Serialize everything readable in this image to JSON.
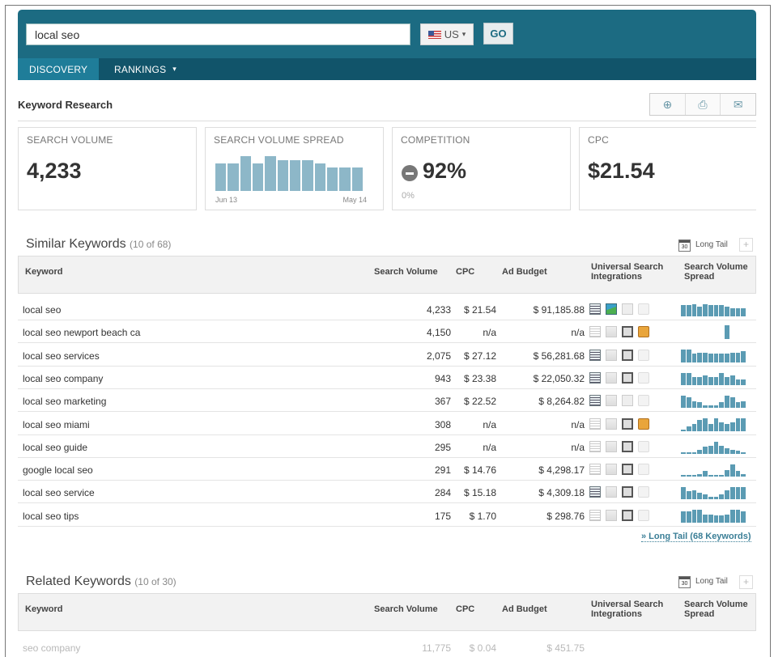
{
  "search": {
    "query": "local seo",
    "country": "US",
    "go_label": "GO"
  },
  "nav": {
    "tabs": [
      "DISCOVERY",
      "RANKINGS"
    ],
    "active": "DISCOVERY",
    "dropdown_caret": "▾"
  },
  "page_title": "Keyword Research",
  "toolbar": {
    "icons": [
      "add-icon",
      "pdf-icon",
      "email-icon"
    ],
    "glyphs": [
      "⊕",
      "⎙",
      "✉"
    ]
  },
  "cards": {
    "search_volume": {
      "label": "SEARCH VOLUME",
      "value": "4,233"
    },
    "spread": {
      "label": "SEARCH VOLUME SPREAD",
      "from": "Jun 13",
      "to": "May 14",
      "levels": [
        0.75,
        0.75,
        0.95,
        0.75,
        0.95,
        0.85,
        0.85,
        0.85,
        0.75,
        0.65,
        0.65,
        0.65
      ]
    },
    "competition": {
      "label": "COMPETITION",
      "value": "92%",
      "sub": "0%"
    },
    "cpc": {
      "label": "CPC",
      "value": "$21.54"
    }
  },
  "similar": {
    "title": "Similar Keywords",
    "count": "(10 of 68)",
    "long_tail_label": "Long Tail",
    "calendar_number": "30",
    "plus": "+",
    "more_link": "» Long Tail (68 Keywords)"
  },
  "columns": {
    "keyword": "Keyword",
    "volume": "Search Volume",
    "cpc": "CPC",
    "budget": "Ad Budget",
    "usi": "Universal Search Integrations",
    "spread": "Search Volume Spread"
  },
  "rows": [
    {
      "keyword": "local seo",
      "volume": "4,233",
      "cpc": "$ 21.54",
      "budget": "$ 91,185.88",
      "usi": [
        1,
        1,
        0,
        0
      ],
      "spread": [
        0.8,
        0.8,
        0.9,
        0.7,
        0.9,
        0.8,
        0.8,
        0.8,
        0.7,
        0.6,
        0.6,
        0.6
      ]
    },
    {
      "keyword": "local seo newport beach ca",
      "volume": "4,150",
      "cpc": "n/a",
      "budget": "n/a",
      "usi": [
        0,
        0,
        1,
        1
      ],
      "spread": [
        0,
        0,
        0,
        0,
        0,
        0,
        0,
        0,
        1,
        0,
        0,
        0
      ]
    },
    {
      "keyword": "local seo services",
      "volume": "2,075",
      "cpc": "$ 27.12",
      "budget": "$ 56,281.68",
      "usi": [
        1,
        0,
        1,
        0
      ],
      "spread": [
        0.9,
        0.9,
        0.6,
        0.7,
        0.7,
        0.6,
        0.6,
        0.6,
        0.6,
        0.7,
        0.7,
        0.8
      ]
    },
    {
      "keyword": "local seo company",
      "volume": "943",
      "cpc": "$ 23.38",
      "budget": "$ 22,050.32",
      "usi": [
        1,
        0,
        1,
        0
      ],
      "spread": [
        0.9,
        0.9,
        0.6,
        0.6,
        0.7,
        0.6,
        0.6,
        0.9,
        0.6,
        0.7,
        0.4,
        0.4
      ]
    },
    {
      "keyword": "local seo marketing",
      "volume": "367",
      "cpc": "$ 22.52",
      "budget": "$ 8,264.82",
      "usi": [
        1,
        0,
        0,
        0
      ],
      "spread": [
        0.9,
        0.8,
        0.5,
        0.4,
        0.2,
        0.2,
        0.2,
        0.4,
        0.9,
        0.8,
        0.4,
        0.5
      ]
    },
    {
      "keyword": "local seo miami",
      "volume": "308",
      "cpc": "n/a",
      "budget": "n/a",
      "usi": [
        0,
        0,
        1,
        1
      ],
      "spread": [
        0.1,
        0.3,
        0.5,
        0.8,
        0.9,
        0.5,
        0.9,
        0.6,
        0.5,
        0.6,
        0.9,
        0.9
      ]
    },
    {
      "keyword": "local seo guide",
      "volume": "295",
      "cpc": "n/a",
      "budget": "n/a",
      "usi": [
        0,
        0,
        1,
        0
      ],
      "spread": [
        0.1,
        0.1,
        0.1,
        0.3,
        0.5,
        0.6,
        0.9,
        0.6,
        0.4,
        0.3,
        0.2,
        0.1
      ]
    },
    {
      "keyword": "google local seo",
      "volume": "291",
      "cpc": "$ 14.76",
      "budget": "$ 4,298.17",
      "usi": [
        0,
        0,
        1,
        0
      ],
      "spread": [
        0.1,
        0.1,
        0.1,
        0.2,
        0.4,
        0.1,
        0.1,
        0.1,
        0.5,
        0.9,
        0.4,
        0.2
      ]
    },
    {
      "keyword": "local seo service",
      "volume": "284",
      "cpc": "$ 15.18",
      "budget": "$ 4,309.18",
      "usi": [
        1,
        0,
        1,
        0
      ],
      "spread": [
        0.9,
        0.6,
        0.7,
        0.5,
        0.4,
        0.2,
        0.2,
        0.4,
        0.7,
        0.9,
        0.9,
        0.9
      ]
    },
    {
      "keyword": "local seo tips",
      "volume": "175",
      "cpc": "$ 1.70",
      "budget": "$ 298.76",
      "usi": [
        0,
        0,
        1,
        0
      ],
      "spread": [
        0.8,
        0.8,
        0.9,
        0.9,
        0.6,
        0.6,
        0.5,
        0.5,
        0.6,
        0.9,
        0.9,
        0.8
      ]
    }
  ],
  "related": {
    "title": "Related Keywords",
    "count": "(10 of 30)",
    "long_tail_label": "Long Tail",
    "calendar_number": "30",
    "plus": "+",
    "partial_row": {
      "keyword": "seo company",
      "volume": "11,775",
      "cpc": "$ 0.04",
      "budget": "$ 451.75"
    }
  }
}
